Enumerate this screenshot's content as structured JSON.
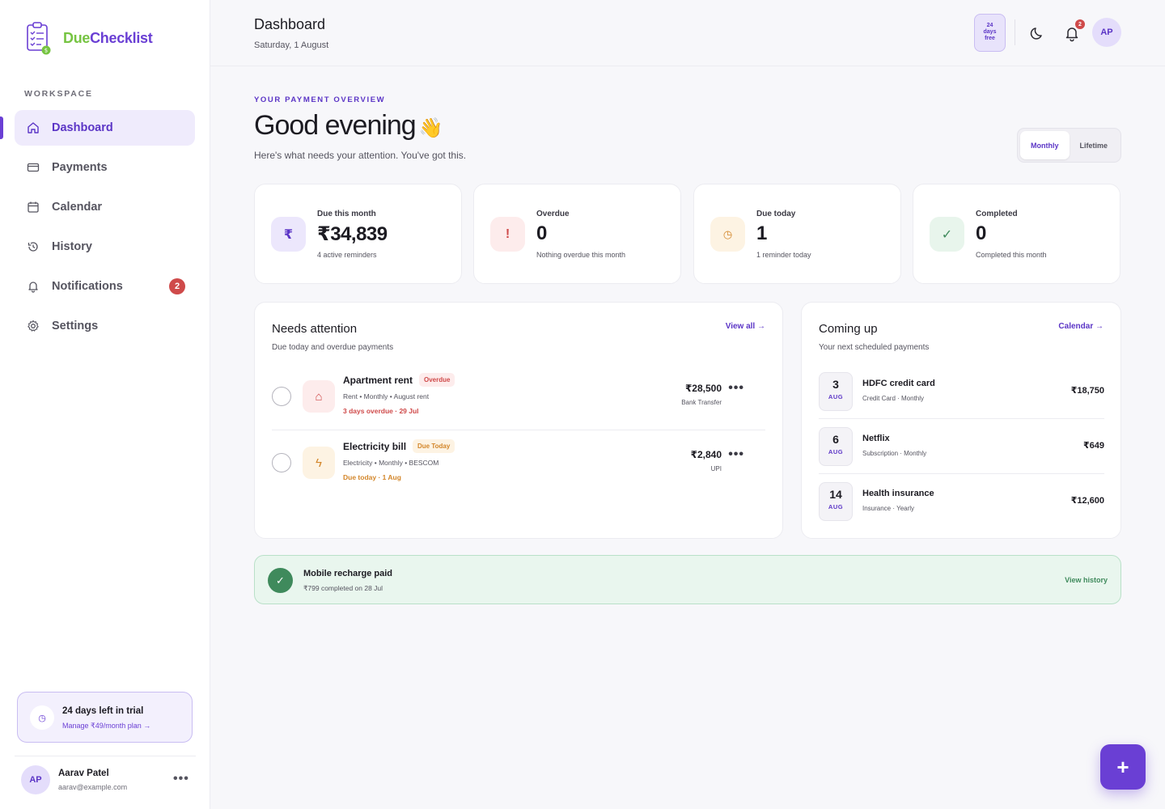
{
  "app": {
    "logo_due": "Due",
    "logo_checklist": "Checklist",
    "logo_badge": "$"
  },
  "sidebar": {
    "section_label": "WORKSPACE",
    "items": [
      {
        "label": "Dashboard",
        "icon": "home-icon",
        "active": true
      },
      {
        "label": "Payments",
        "icon": "card-icon"
      },
      {
        "label": "Calendar",
        "icon": "calendar-icon"
      },
      {
        "label": "History",
        "icon": "history-icon"
      },
      {
        "label": "Notifications",
        "icon": "bell-icon",
        "badge": "2"
      },
      {
        "label": "Settings",
        "icon": "gear-icon"
      }
    ],
    "trial": {
      "title": "24 days left in trial",
      "link": "Manage ₹49/month plan →",
      "icon": "clock-icon"
    },
    "user": {
      "initials": "AP",
      "name": "Aarav Patel",
      "email": "aarav@example.com",
      "more": "•••"
    }
  },
  "header": {
    "title": "Dashboard",
    "date": "Saturday, 1 August",
    "trial_chip": [
      "24",
      "days",
      "free"
    ],
    "notification_count": "2",
    "avatar_initials": "AP"
  },
  "overview": {
    "eyebrow": "YOUR PAYMENT OVERVIEW",
    "greeting": "Good evening",
    "greeting_emoji": "👋",
    "subtitle": "Here's what needs your attention. You've got this.",
    "toggle": {
      "options": [
        "Monthly",
        "Lifetime"
      ],
      "selected": "Monthly"
    }
  },
  "stats": [
    {
      "label": "Due this month",
      "value": "₹34,839",
      "sub": "4 active reminders",
      "icon": "₹",
      "icon_bg": "#ece7fc",
      "icon_color": "#5b35c6"
    },
    {
      "label": "Overdue",
      "value": "0",
      "sub": "Nothing overdue this month",
      "icon": "!",
      "icon_bg": "#fdecec",
      "icon_color": "#cf4a4a"
    },
    {
      "label": "Due today",
      "value": "1",
      "sub": "1 reminder today",
      "icon": "◷",
      "icon_bg": "#fdf3e3",
      "icon_color": "#d3862a"
    },
    {
      "label": "Completed",
      "value": "0",
      "sub": "Completed this month",
      "icon": "✓",
      "icon_bg": "#e8f5ec",
      "icon_color": "#3f8a5c"
    }
  ],
  "needs_attention": {
    "title": "Needs attention",
    "subtitle": "Due today and overdue payments",
    "link": "View all →",
    "items": [
      {
        "name": "Apartment rent",
        "tag": "Overdue",
        "meta": "Rent  •  Monthly •  August rent",
        "due": "3 days overdue · 29 Jul",
        "amount": "₹28,500",
        "method": "Bank Transfer",
        "icon": "⌂",
        "more": "•••"
      },
      {
        "name": "Electricity bill",
        "tag": "Due Today",
        "meta": "Electricity  •  Monthly •  BESCOM",
        "due": "Due today · 1 Aug",
        "amount": "₹2,840",
        "method": "UPI",
        "icon": "ϟ",
        "more": "•••"
      }
    ]
  },
  "coming_up": {
    "title": "Coming up",
    "subtitle": "Your next scheduled payments",
    "link": "Calendar →",
    "items": [
      {
        "day": "3",
        "month": "AUG",
        "name": "HDFC credit card",
        "meta": "Credit Card · Monthly",
        "amount": "₹18,750"
      },
      {
        "day": "6",
        "month": "AUG",
        "name": "Netflix",
        "meta": "Subscription · Monthly",
        "amount": "₹649"
      },
      {
        "day": "14",
        "month": "AUG",
        "name": "Health insurance",
        "meta": "Insurance · Yearly",
        "amount": "₹12,600"
      }
    ]
  },
  "banner": {
    "title": "Mobile recharge paid",
    "sub": "₹799 completed on 28 Jul",
    "link": "View history",
    "icon": "✓"
  },
  "fab": {
    "label": "+"
  }
}
